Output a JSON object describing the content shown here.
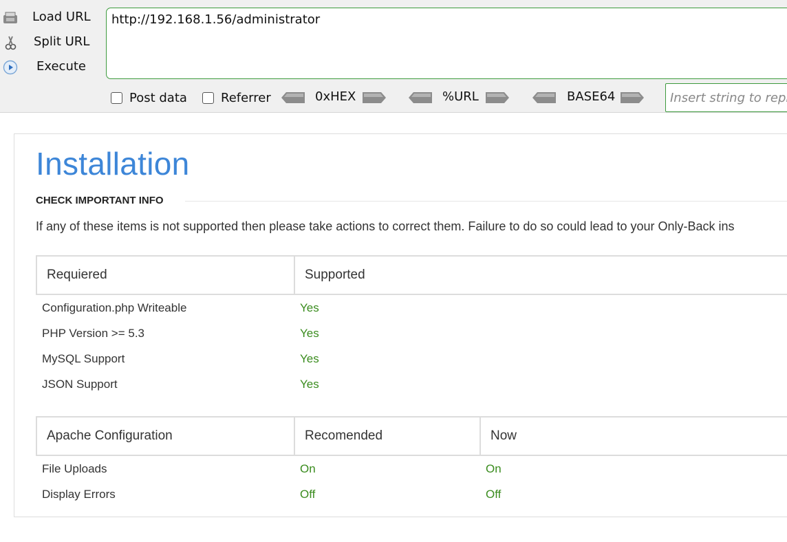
{
  "hackbar": {
    "load_url": "Load URL",
    "split_url": "Split URL",
    "execute": "Execute",
    "url_value": "http://192.168.1.56/administrator",
    "post_data": "Post data",
    "referrer": "Referrer",
    "encoders": [
      "0xHEX",
      "%URL",
      "BASE64"
    ],
    "replace_placeholder": "Insert string to repla",
    "icons": {
      "load": "load-url-icon",
      "split": "scissors-icon",
      "execute": "play-icon"
    }
  },
  "page": {
    "title": "Installation",
    "section": "CHECK IMPORTANT INFO",
    "intro": "If any of these items is not supported then please take actions to correct them. Failure to do so could lead to your Only-Back ins"
  },
  "required_table": {
    "headers": [
      "Requiered",
      "Supported"
    ],
    "rows": [
      {
        "item": "Configuration.php Writeable",
        "supported": "Yes"
      },
      {
        "item": "PHP Version >= 5.3",
        "supported": "Yes"
      },
      {
        "item": "MySQL Support",
        "supported": "Yes"
      },
      {
        "item": "JSON Support",
        "supported": "Yes"
      }
    ]
  },
  "apache_table": {
    "headers": [
      "Apache Configuration",
      "Recomended",
      "Now"
    ],
    "rows": [
      {
        "item": "File Uploads",
        "recommended": "On",
        "now": "On"
      },
      {
        "item": "Display Errors",
        "recommended": "Off",
        "now": "Off"
      }
    ]
  },
  "colors": {
    "title_blue": "#3d86d8",
    "ok_green": "#3a8c1e",
    "focus_green": "#3c9a3c"
  }
}
